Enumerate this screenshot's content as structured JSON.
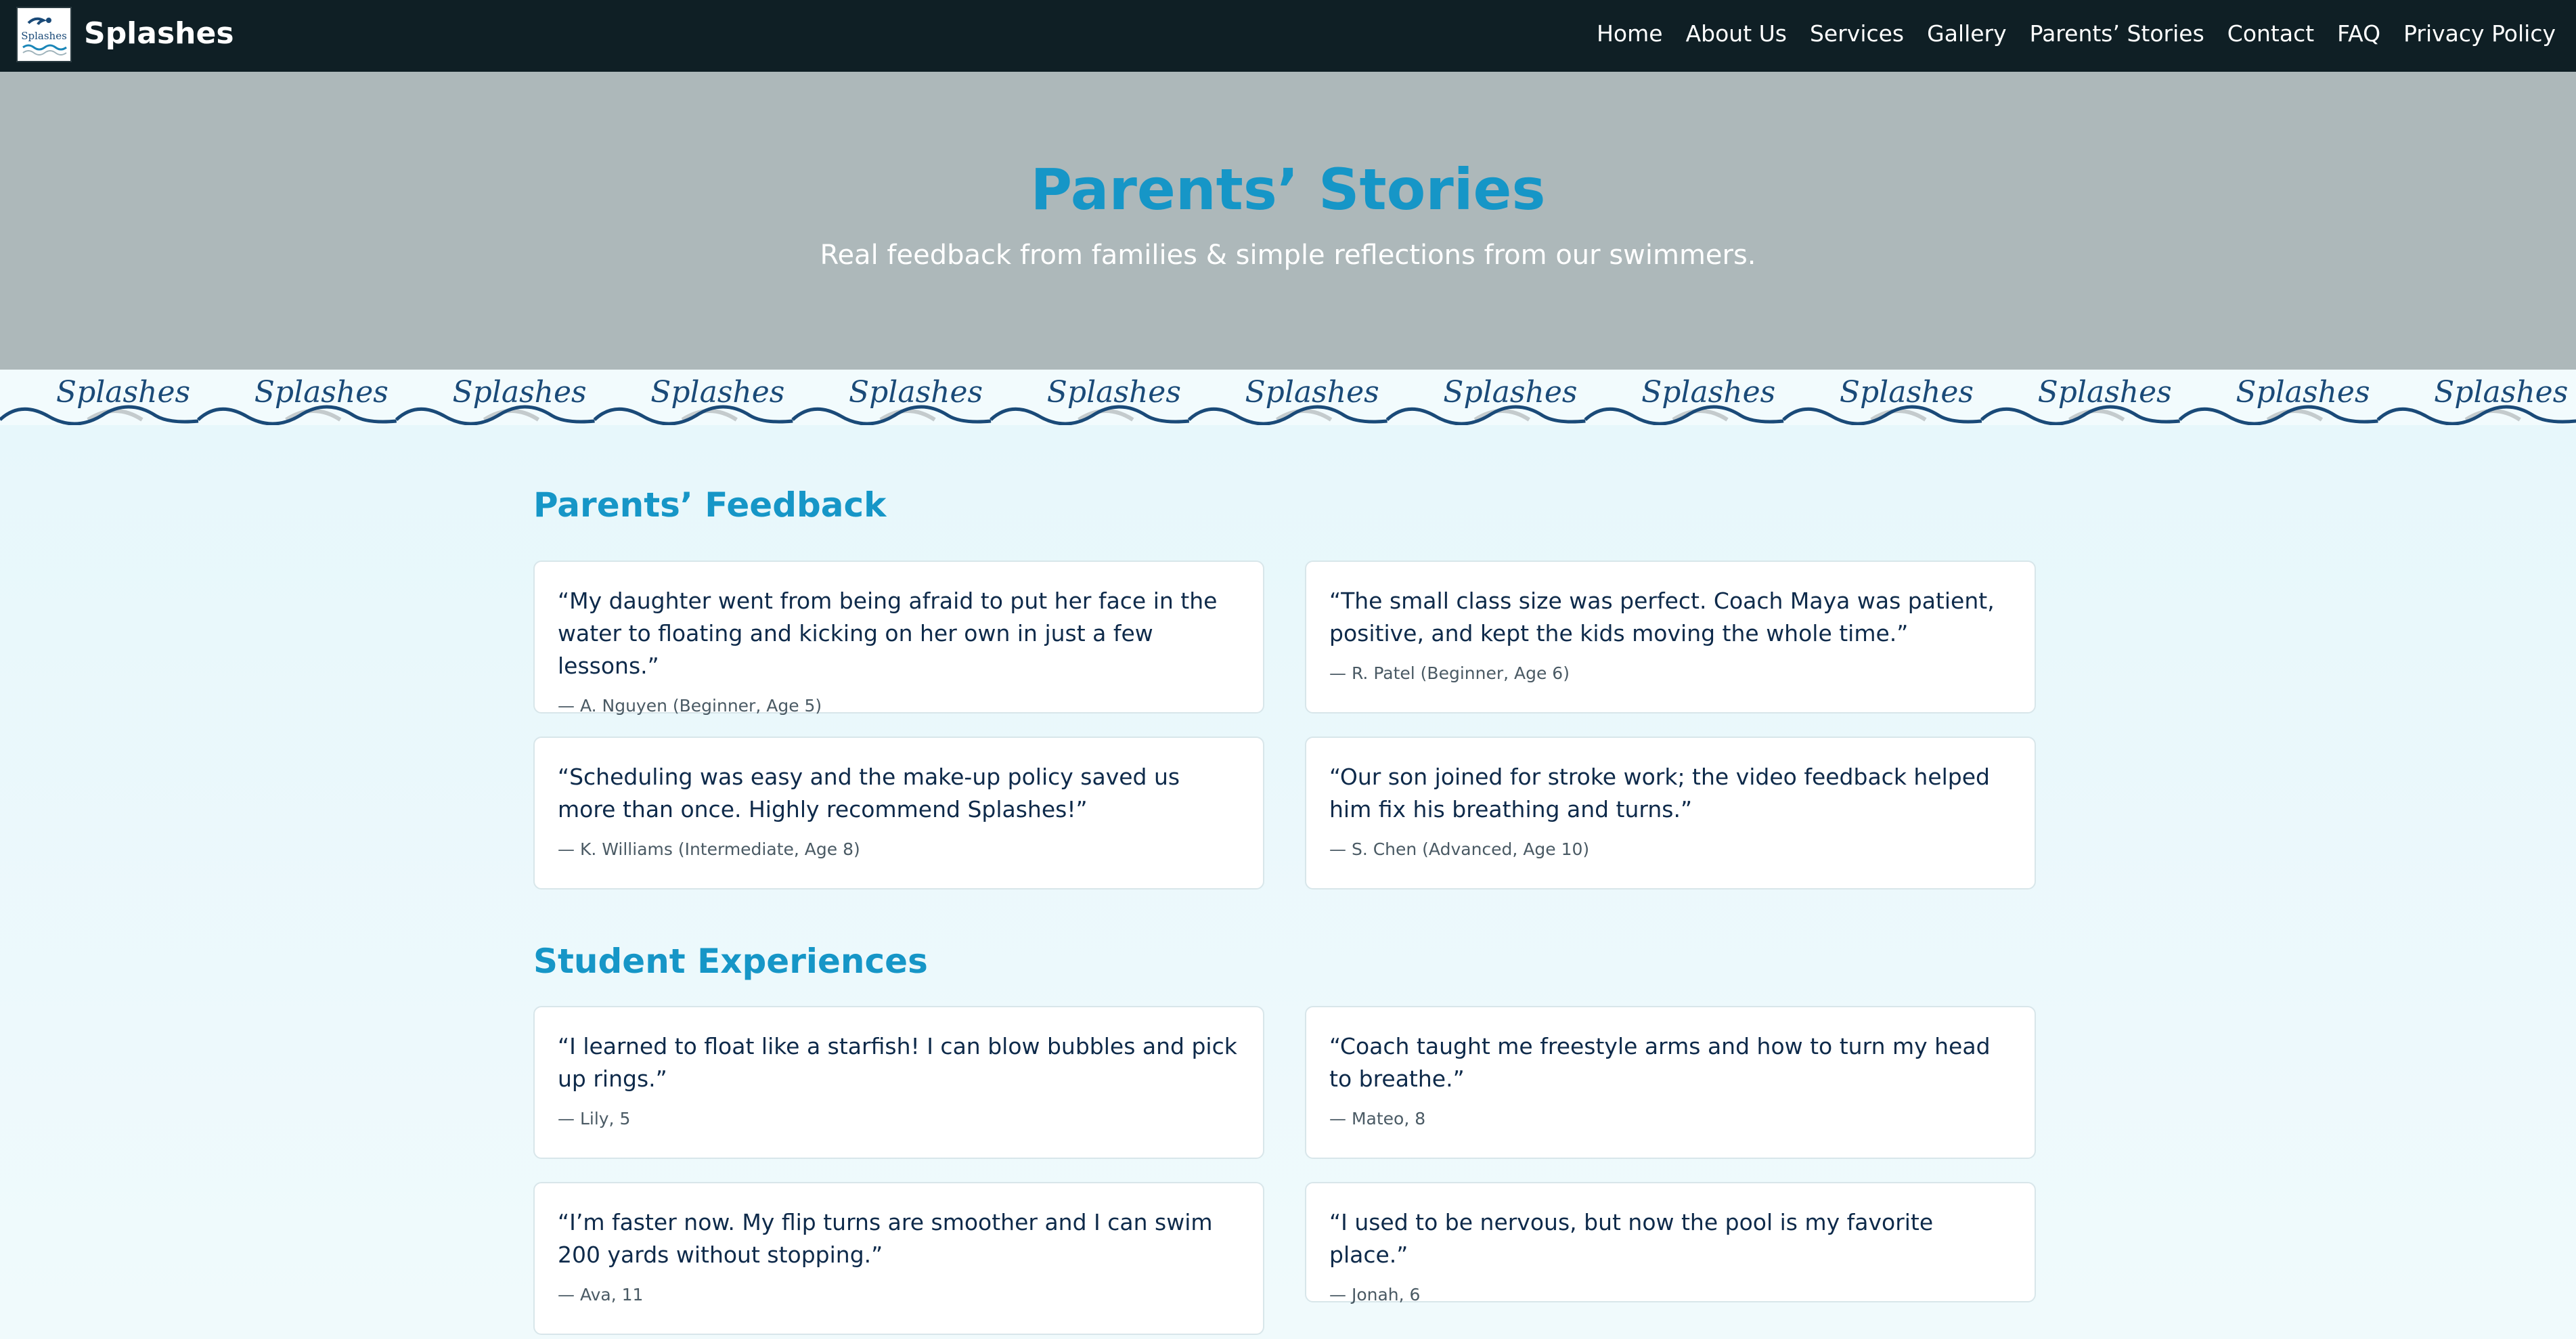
{
  "navbar": {
    "brand": "Splashes",
    "logo_text": "Splashes",
    "items": [
      "Home",
      "About Us",
      "Services",
      "Gallery",
      "Parents’ Stories",
      "Contact",
      "FAQ",
      "Privacy Policy"
    ]
  },
  "hero": {
    "title": "Parents’ Stories",
    "subtitle": "Real feedback from families & simple reflections from our swimmers."
  },
  "wave_banner": {
    "text": "Splashes",
    "repeat_count": 13
  },
  "sections": [
    {
      "title": "Parents’ Feedback",
      "cards": [
        {
          "quote": "“My daughter went from being afraid to put her face in the water to floating and kicking on her own in just a few lessons.”",
          "author": "— A. Nguyen (Beginner, Age 5)"
        },
        {
          "quote": "“The small class size was perfect. Coach Maya was patient, positive, and kept the kids moving the whole time.”",
          "author": "— R. Patel (Beginner, Age 6)"
        },
        {
          "quote": "“Scheduling was easy and the make-up policy saved us more than once. Highly recommend Splashes!”",
          "author": "— K. Williams (Intermediate, Age 8)"
        },
        {
          "quote": "“Our son joined for stroke work; the video feedback helped him fix his breathing and turns.”",
          "author": "— S. Chen (Advanced, Age 10)"
        }
      ]
    },
    {
      "title": "Student Experiences",
      "cards": [
        {
          "quote": "“I learned to float like a starfish! I can blow bubbles and pick up rings.”",
          "author": "— Lily, 5"
        },
        {
          "quote": "“Coach taught me freestyle arms and how to turn my head to breathe.”",
          "author": "— Mateo, 8"
        },
        {
          "quote": "“I’m faster now. My flip turns are smoother and I can swim 200 yards without stopping.”",
          "author": "— Ava, 11"
        },
        {
          "quote": "“I used to be nervous, but now the pool is my favorite place.”",
          "author": "— Jonah, 6"
        }
      ]
    }
  ],
  "colors": {
    "nav_bg": "#0f1f25",
    "hero_bg": "#adb8ba",
    "accent": "#1696c7",
    "wave_dark": "#1a4a78",
    "wave_light": "#c4cbcd",
    "text_dark": "#0e2a4a"
  }
}
